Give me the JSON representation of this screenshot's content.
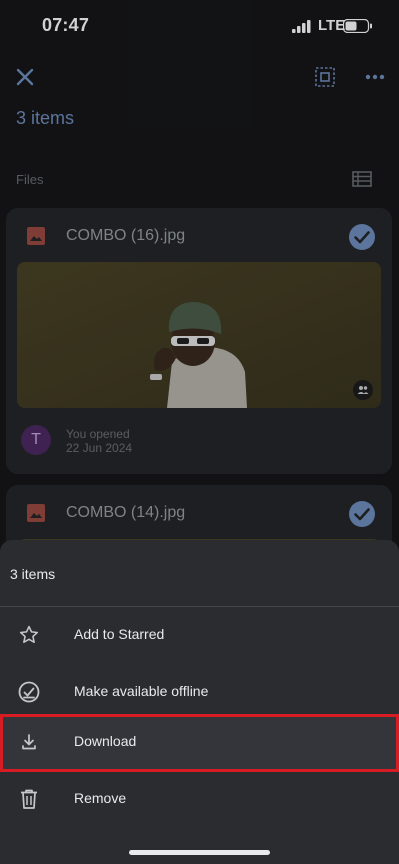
{
  "status_bar": {
    "time": "07:47",
    "network": "LTE"
  },
  "top_bar": {
    "close_icon": "close-icon",
    "select_all_icon": "select-all-icon",
    "more_icon": "more-horizontal-icon"
  },
  "selection": {
    "count_label": "3 items"
  },
  "section": {
    "label": "Files",
    "view_icon": "list-view-icon"
  },
  "files": [
    {
      "name": "COMBO (16).jpg",
      "selected": true,
      "activity_line1": "You opened",
      "activity_line2": "22 Jun 2024",
      "avatar_initial": "T"
    },
    {
      "name": "COMBO (14).jpg",
      "selected": true
    }
  ],
  "bottom_sheet": {
    "title": "3 items",
    "items": [
      {
        "label": "Add to Starred",
        "icon": "star-outline-icon"
      },
      {
        "label": "Make available offline",
        "icon": "offline-check-icon"
      },
      {
        "label": "Download",
        "icon": "download-icon"
      },
      {
        "label": "Remove",
        "icon": "trash-icon"
      }
    ]
  },
  "colors": {
    "accent": "#6f8fbf",
    "highlight": "#d81c24",
    "sheet_bg": "#2b2c30",
    "card_bg": "#24262a",
    "page_bg": "#161719"
  }
}
